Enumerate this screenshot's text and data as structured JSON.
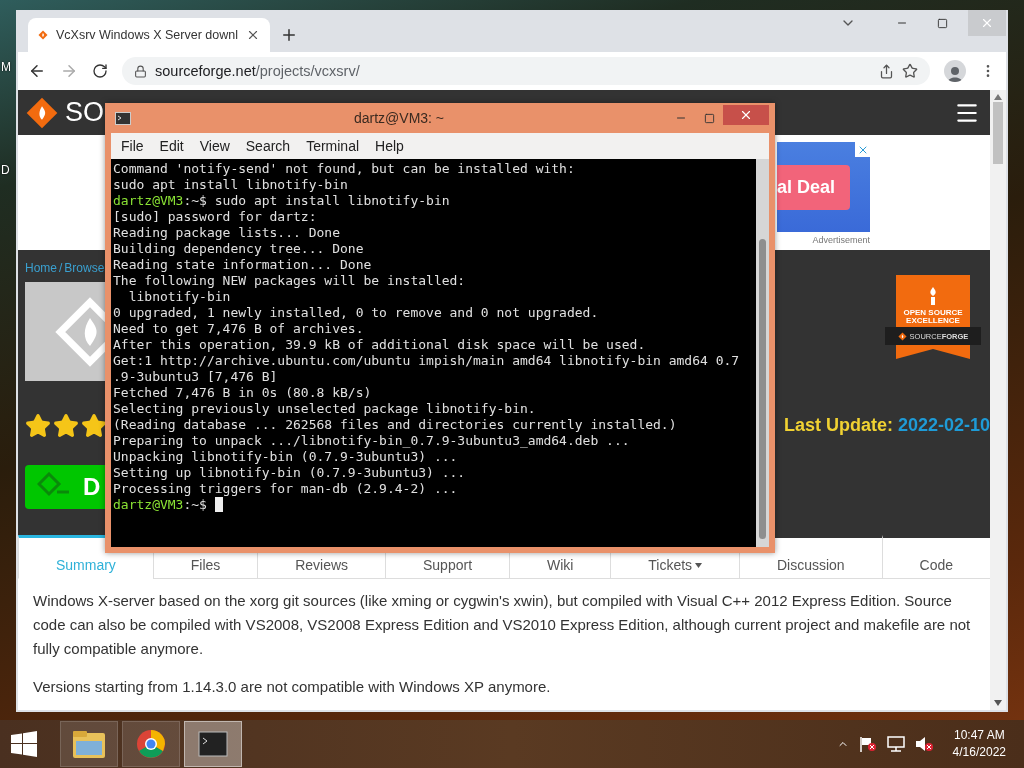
{
  "desktop": {
    "icon_labels": [
      "M",
      "D"
    ]
  },
  "browser": {
    "tab": {
      "title": "VcXsrv Windows X Server downl",
      "selected": true
    },
    "address": {
      "host": "sourceforge.net",
      "path": "/projects/vcxsrv/"
    },
    "page": {
      "logo_text": "SO",
      "ad": {
        "button": "al Deal",
        "label": "Advertisement"
      },
      "breadcrumb": {
        "items": [
          "Home",
          "Browse"
        ],
        "separator": "/"
      },
      "rating": {
        "stars": 3
      },
      "download_button": "D",
      "badge": {
        "line1": "OPEN SOURCE",
        "line2": "EXCELLENCE",
        "ribbon": "SOURCE**FORGE**"
      },
      "last_update": {
        "label": "Last Update:",
        "value": "2022-02-10"
      },
      "tabs": [
        {
          "label": "Summary",
          "selected": true,
          "dropdown": false
        },
        {
          "label": "Files",
          "selected": false,
          "dropdown": false
        },
        {
          "label": "Reviews",
          "selected": false,
          "dropdown": false
        },
        {
          "label": "Support",
          "selected": false,
          "dropdown": false
        },
        {
          "label": "Wiki",
          "selected": false,
          "dropdown": false
        },
        {
          "label": "Tickets",
          "selected": false,
          "dropdown": true
        },
        {
          "label": "Discussion",
          "selected": false,
          "dropdown": false
        },
        {
          "label": "Code",
          "selected": false,
          "dropdown": false
        }
      ],
      "description": [
        "Windows X-server based on the xorg git sources (like xming or cygwin's xwin), but compiled with Visual C++ 2012 Express Edition. Source code can also be compiled with VS2008, VS2008 Express Edition and VS2010 Express Edition, although current project and makefile are not fully compatible anymore.",
        "Versions starting from 1.14.3.0 are not compatible with Windows XP anymore."
      ]
    }
  },
  "terminal": {
    "title": "dartz@VM3: ~",
    "menu": [
      "File",
      "Edit",
      "View",
      "Search",
      "Terminal",
      "Help"
    ],
    "cursor": true,
    "lines": [
      {
        "kind": "output",
        "text": "Command 'notify-send' not found, but can be installed with:"
      },
      {
        "kind": "output",
        "text": "sudo apt install libnotify-bin"
      },
      {
        "kind": "prompt",
        "user": "dartz@VM3",
        "path": ":~$",
        "command": "sudo apt install libnotify-bin"
      },
      {
        "kind": "output",
        "text": "[sudo] password for dartz:"
      },
      {
        "kind": "output",
        "text": "Reading package lists... Done"
      },
      {
        "kind": "output",
        "text": "Building dependency tree... Done"
      },
      {
        "kind": "output",
        "text": "Reading state information... Done"
      },
      {
        "kind": "output",
        "text": "The following NEW packages will be installed:"
      },
      {
        "kind": "output",
        "text": "  libnotify-bin"
      },
      {
        "kind": "output",
        "text": "0 upgraded, 1 newly installed, 0 to remove and 0 not upgraded."
      },
      {
        "kind": "output",
        "text": "Need to get 7,476 B of archives."
      },
      {
        "kind": "output",
        "text": "After this operation, 39.9 kB of additional disk space will be used."
      },
      {
        "kind": "output",
        "text": "Get:1 http://archive.ubuntu.com/ubuntu impish/main amd64 libnotify-bin amd64 0.7"
      },
      {
        "kind": "output",
        "text": ".9-3ubuntu3 [7,476 B]"
      },
      {
        "kind": "output",
        "text": "Fetched 7,476 B in 0s (80.8 kB/s)"
      },
      {
        "kind": "output",
        "text": "Selecting previously unselected package libnotify-bin."
      },
      {
        "kind": "output",
        "text": "(Reading database ... 262568 files and directories currently installed.)"
      },
      {
        "kind": "output",
        "text": "Preparing to unpack .../libnotify-bin_0.7.9-3ubuntu3_amd64.deb ..."
      },
      {
        "kind": "output",
        "text": "Unpacking libnotify-bin (0.7.9-3ubuntu3) ..."
      },
      {
        "kind": "output",
        "text": "Setting up libnotify-bin (0.7.9-3ubuntu3) ..."
      },
      {
        "kind": "output",
        "text": "Processing triggers for man-db (2.9.4-2) ..."
      },
      {
        "kind": "prompt",
        "user": "dartz@VM3",
        "path": ":~$"
      }
    ]
  },
  "taskbar": {
    "apps": [
      {
        "kind": "explorer",
        "active": false
      },
      {
        "kind": "chrome",
        "active": false
      },
      {
        "kind": "terminal",
        "active": true
      }
    ],
    "volume": {
      "muted": true
    },
    "clock": {
      "time": "10:47 AM",
      "date": "4/16/2022"
    }
  }
}
